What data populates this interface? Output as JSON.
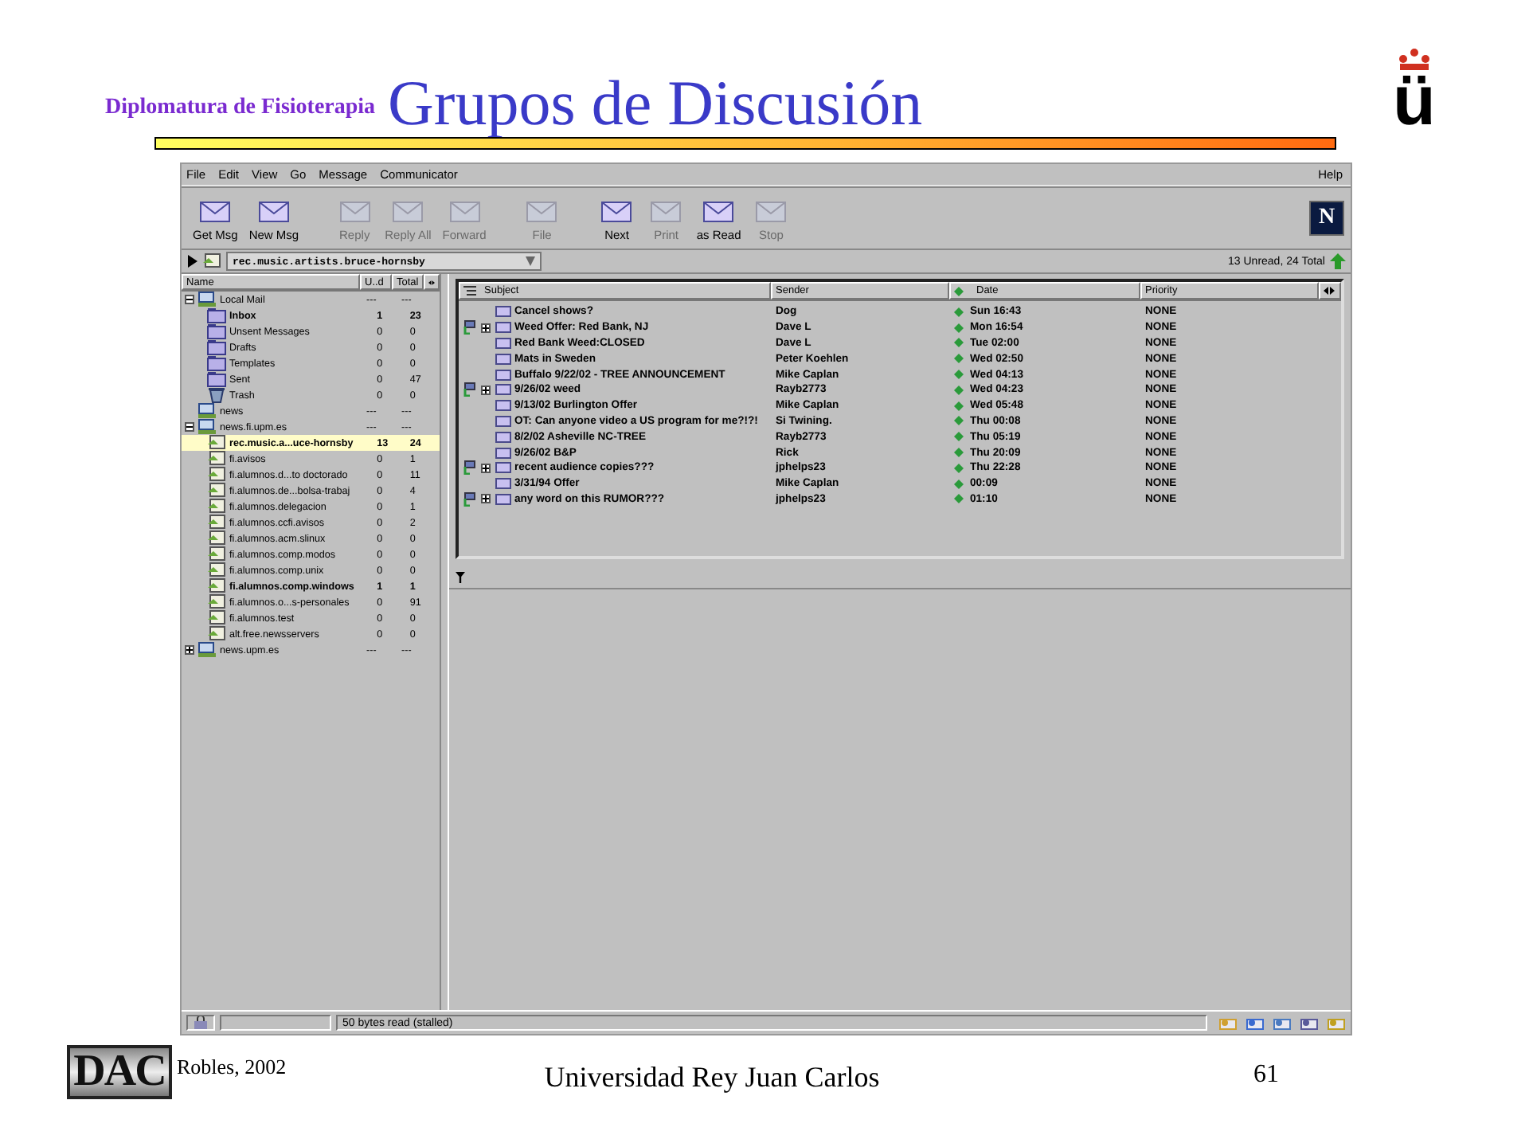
{
  "slide": {
    "subtitle": "Diplomatura de Fisioterapia",
    "title": "Grupos de Discusión",
    "logo": "ü"
  },
  "window": {
    "menu": [
      "File",
      "Edit",
      "View",
      "Go",
      "Message",
      "Communicator"
    ],
    "help_menu": "Help",
    "toolbar": [
      {
        "label": "Get Msg",
        "disabled": false
      },
      {
        "label": "New Msg",
        "disabled": false
      },
      {
        "label": "Reply",
        "disabled": true
      },
      {
        "label": "Reply All",
        "disabled": true
      },
      {
        "label": "Forward",
        "disabled": true
      },
      {
        "label": "File",
        "disabled": true
      },
      {
        "label": "Next",
        "disabled": false
      },
      {
        "label": "Print",
        "disabled": true
      },
      {
        "label": "as Read",
        "disabled": false
      },
      {
        "label": "Stop",
        "disabled": true
      }
    ],
    "brand_logo": "N",
    "location": {
      "folder": "rec.music.artists.bruce-hornsby",
      "counts": "13 Unread, 24 Total"
    },
    "folder_columns": [
      "Name",
      "U..d",
      "Total"
    ],
    "folders": [
      {
        "name": "Local Mail",
        "kind": "server",
        "expanded": true,
        "unread": "---",
        "total": "---",
        "bold": false,
        "selected": false,
        "children": [
          {
            "name": "Inbox",
            "kind": "folder",
            "unread": "1",
            "total": "23",
            "bold": true,
            "selected": false
          },
          {
            "name": "Unsent Messages",
            "kind": "folder",
            "unread": "0",
            "total": "0",
            "bold": false,
            "selected": false
          },
          {
            "name": "Drafts",
            "kind": "folder",
            "unread": "0",
            "total": "0",
            "bold": false,
            "selected": false
          },
          {
            "name": "Templates",
            "kind": "folder",
            "unread": "0",
            "total": "0",
            "bold": false,
            "selected": false
          },
          {
            "name": "Sent",
            "kind": "folder",
            "unread": "0",
            "total": "47",
            "bold": false,
            "selected": false
          },
          {
            "name": "Trash",
            "kind": "trash",
            "unread": "0",
            "total": "0",
            "bold": false,
            "selected": false
          }
        ]
      },
      {
        "name": "news",
        "kind": "server",
        "unread": "---",
        "total": "---",
        "bold": false,
        "selected": false
      },
      {
        "name": "news.fi.upm.es",
        "kind": "server",
        "expanded": true,
        "unread": "---",
        "total": "---",
        "bold": false,
        "selected": false,
        "children": [
          {
            "name": "rec.music.a...uce-hornsby",
            "kind": "group",
            "unread": "13",
            "total": "24",
            "bold": true,
            "selected": true
          },
          {
            "name": "fi.avisos",
            "kind": "group",
            "unread": "0",
            "total": "1",
            "bold": false,
            "selected": false
          },
          {
            "name": "fi.alumnos.d...to doctorado",
            "kind": "group",
            "unread": "0",
            "total": "11",
            "bold": false,
            "selected": false
          },
          {
            "name": "fi.alumnos.de...bolsa-trabaj",
            "kind": "group",
            "unread": "0",
            "total": "4",
            "bold": false,
            "selected": false
          },
          {
            "name": "fi.alumnos.delegacion",
            "kind": "group",
            "unread": "0",
            "total": "1",
            "bold": false,
            "selected": false
          },
          {
            "name": "fi.alumnos.ccfi.avisos",
            "kind": "group",
            "unread": "0",
            "total": "2",
            "bold": false,
            "selected": false
          },
          {
            "name": "fi.alumnos.acm.slinux",
            "kind": "group",
            "unread": "0",
            "total": "0",
            "bold": false,
            "selected": false
          },
          {
            "name": "fi.alumnos.comp.modos",
            "kind": "group",
            "unread": "0",
            "total": "0",
            "bold": false,
            "selected": false
          },
          {
            "name": "fi.alumnos.comp.unix",
            "kind": "group",
            "unread": "0",
            "total": "0",
            "bold": false,
            "selected": false
          },
          {
            "name": "fi.alumnos.comp.windows",
            "kind": "group",
            "unread": "1",
            "total": "1",
            "bold": true,
            "selected": false
          },
          {
            "name": "fi.alumnos.o...s-personales",
            "kind": "group",
            "unread": "0",
            "total": "91",
            "bold": false,
            "selected": false
          },
          {
            "name": "fi.alumnos.test",
            "kind": "group",
            "unread": "0",
            "total": "0",
            "bold": false,
            "selected": false
          },
          {
            "name": "alt.free.newsservers",
            "kind": "group",
            "unread": "0",
            "total": "0",
            "bold": false,
            "selected": false
          }
        ]
      },
      {
        "name": "news.upm.es",
        "kind": "server",
        "expanded": false,
        "unread": "---",
        "total": "---",
        "bold": false,
        "selected": false
      }
    ],
    "message_columns": [
      "Subject",
      "Sender",
      "Date",
      "Priority"
    ],
    "messages": [
      {
        "kind": "message",
        "subject": "Cancel shows?",
        "sender": "Dog",
        "date": "Sun 16:43",
        "priority": "NONE"
      },
      {
        "kind": "thread",
        "expanded": false,
        "subject": "Weed Offer: Red Bank, NJ",
        "sender": "Dave L",
        "date": "Mon 16:54",
        "priority": "NONE"
      },
      {
        "kind": "message",
        "subject": "Red Bank Weed:CLOSED",
        "sender": "Dave L",
        "date": "Tue 02:00",
        "priority": "NONE"
      },
      {
        "kind": "message",
        "subject": "Mats in Sweden",
        "sender": "Peter Koehlen",
        "date": "Wed 02:50",
        "priority": "NONE"
      },
      {
        "kind": "message",
        "subject": "Buffalo 9/22/02 - TREE ANNOUNCEMENT",
        "sender": "Mike Caplan",
        "date": "Wed 04:13",
        "priority": "NONE"
      },
      {
        "kind": "thread",
        "expanded": false,
        "subject": "9/26/02 weed",
        "sender": "Rayb2773",
        "date": "Wed 04:23",
        "priority": "NONE"
      },
      {
        "kind": "message",
        "subject": "9/13/02 Burlington Offer",
        "sender": "Mike Caplan",
        "date": "Wed 05:48",
        "priority": "NONE"
      },
      {
        "kind": "message",
        "subject": "OT: Can anyone video a US program for me?!?!",
        "sender": "Si Twining.",
        "date": "Thu 00:08",
        "priority": "NONE"
      },
      {
        "kind": "message",
        "subject": "8/2/02 Asheville NC-TREE",
        "sender": "Rayb2773",
        "date": "Thu 05:19",
        "priority": "NONE"
      },
      {
        "kind": "message",
        "subject": "9/26/02 B&P",
        "sender": "Rick",
        "date": "Thu 20:09",
        "priority": "NONE"
      },
      {
        "kind": "thread",
        "expanded": false,
        "subject": "recent audience copies???",
        "sender": "jphelps23",
        "date": "Thu 22:28",
        "priority": "NONE"
      },
      {
        "kind": "message",
        "subject": "3/31/94 Offer",
        "sender": "Mike Caplan",
        "date": "00:09",
        "priority": "NONE"
      },
      {
        "kind": "thread",
        "expanded": false,
        "subject": "any word on this RUMOR???",
        "sender": "jphelps23",
        "date": "01:10",
        "priority": "NONE"
      }
    ],
    "status": "50 bytes read (stalled)"
  },
  "footer": {
    "logo": "DAC",
    "author": "Robles, 2002",
    "institution": "Universidad Rey Juan Carlos",
    "page": "61"
  }
}
